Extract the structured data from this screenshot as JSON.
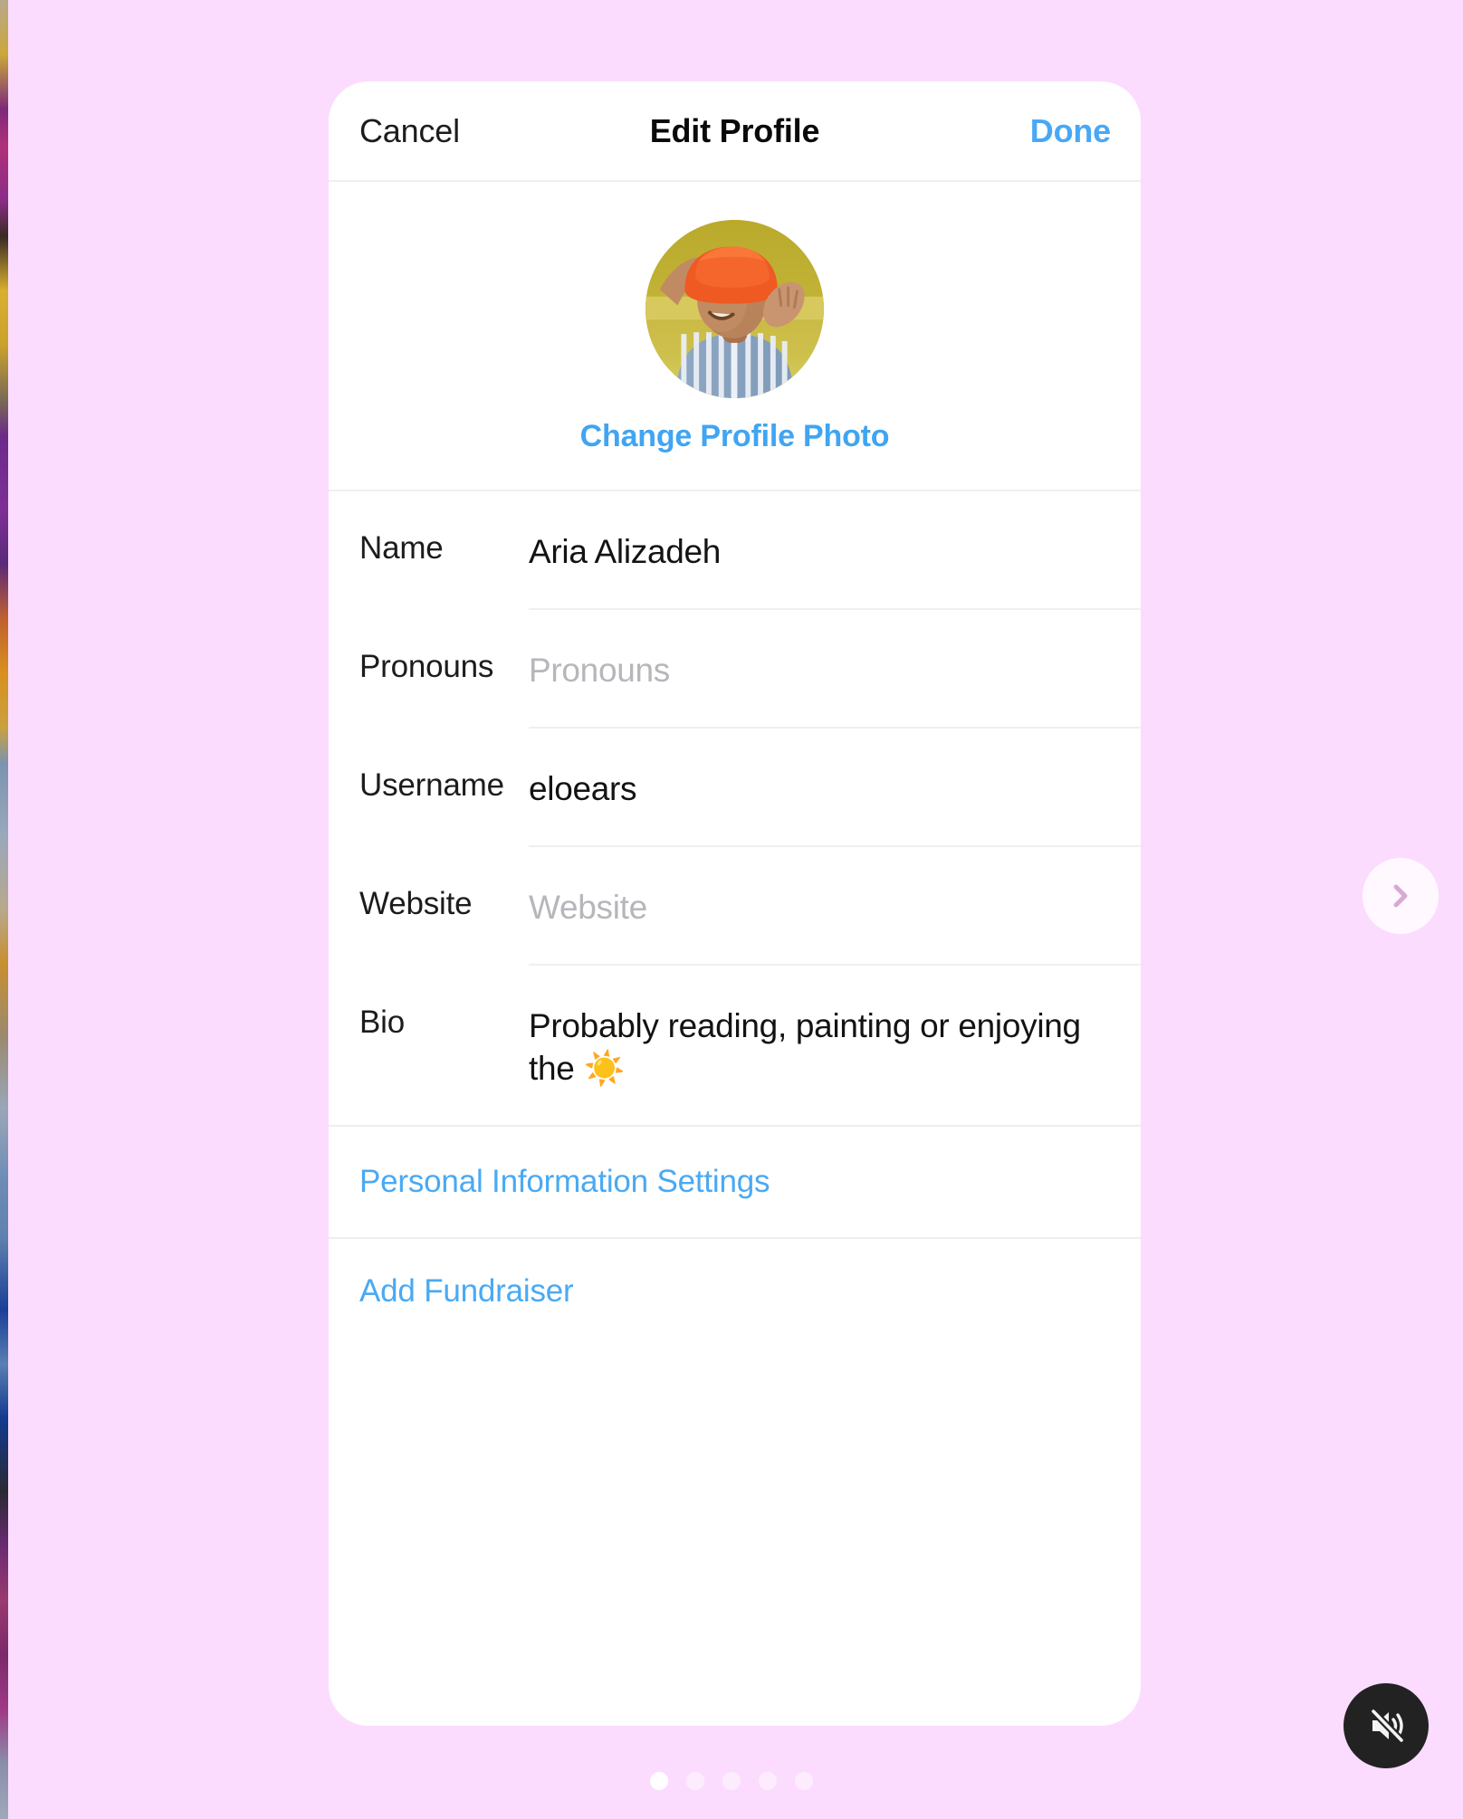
{
  "background_color": "#fcdcfe",
  "accent_blue": "#45a7f3",
  "card": {
    "navbar": {
      "cancel_label": "Cancel",
      "title": "Edit Profile",
      "done_label": "Done"
    },
    "avatar": {
      "alt": "profile-photo",
      "change_photo_label": "Change Profile Photo"
    },
    "fields": [
      {
        "label": "Name",
        "value": "Aria Alizadeh",
        "placeholder": "Name",
        "is_placeholder": false
      },
      {
        "label": "Pronouns",
        "value": "Pronouns",
        "placeholder": "Pronouns",
        "is_placeholder": true
      },
      {
        "label": "Username",
        "value": "eloears",
        "placeholder": "Username",
        "is_placeholder": false
      },
      {
        "label": "Website",
        "value": "Website",
        "placeholder": "Website",
        "is_placeholder": true
      },
      {
        "label": "Bio",
        "value": "Probably reading, painting or enjoying the ☀️",
        "placeholder": "Bio",
        "is_placeholder": false
      }
    ],
    "links": [
      {
        "label": "Personal Information Settings"
      },
      {
        "label": "Add Fundraiser"
      }
    ]
  },
  "carousel": {
    "next_button_icon": "chevron-right-icon",
    "mute_button_icon": "speaker-muted-icon",
    "dots": [
      {
        "active": true
      },
      {
        "active": false
      },
      {
        "active": false
      },
      {
        "active": false
      },
      {
        "active": false
      }
    ]
  }
}
